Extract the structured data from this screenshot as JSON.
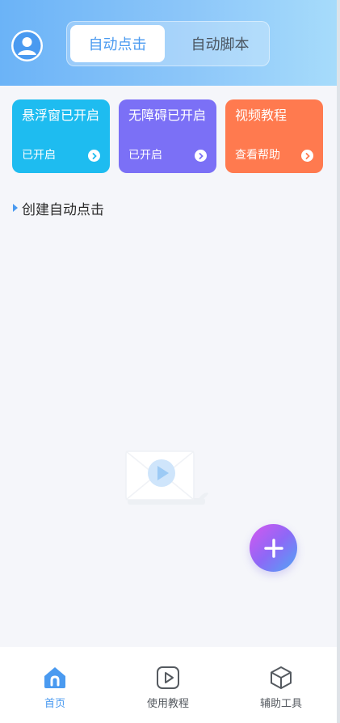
{
  "header": {
    "tabs": [
      {
        "label": "自动点击",
        "active": true
      },
      {
        "label": "自动脚本",
        "active": false
      }
    ],
    "avatar_icon": "user-icon"
  },
  "cards": [
    {
      "title": "悬浮窗已开启",
      "status": "已开启",
      "color": "#1ebcf0"
    },
    {
      "title": "无障碍已开启",
      "status": "已开启",
      "color": "#7b70f6"
    },
    {
      "title": "视频教程",
      "status": "查看帮助",
      "color": "#ff7a4f"
    }
  ],
  "section": {
    "title": "创建自动点击"
  },
  "fab": {
    "icon": "plus-icon"
  },
  "tabbar": {
    "items": [
      {
        "label": "首页",
        "icon": "home-icon",
        "active": true
      },
      {
        "label": "使用教程",
        "icon": "play-icon",
        "active": false
      },
      {
        "label": "辅助工具",
        "icon": "cube-icon",
        "active": false
      }
    ]
  },
  "colors": {
    "accent": "#4a9af0",
    "header_from": "#6bb3f7",
    "header_to": "#a7dcfb"
  }
}
